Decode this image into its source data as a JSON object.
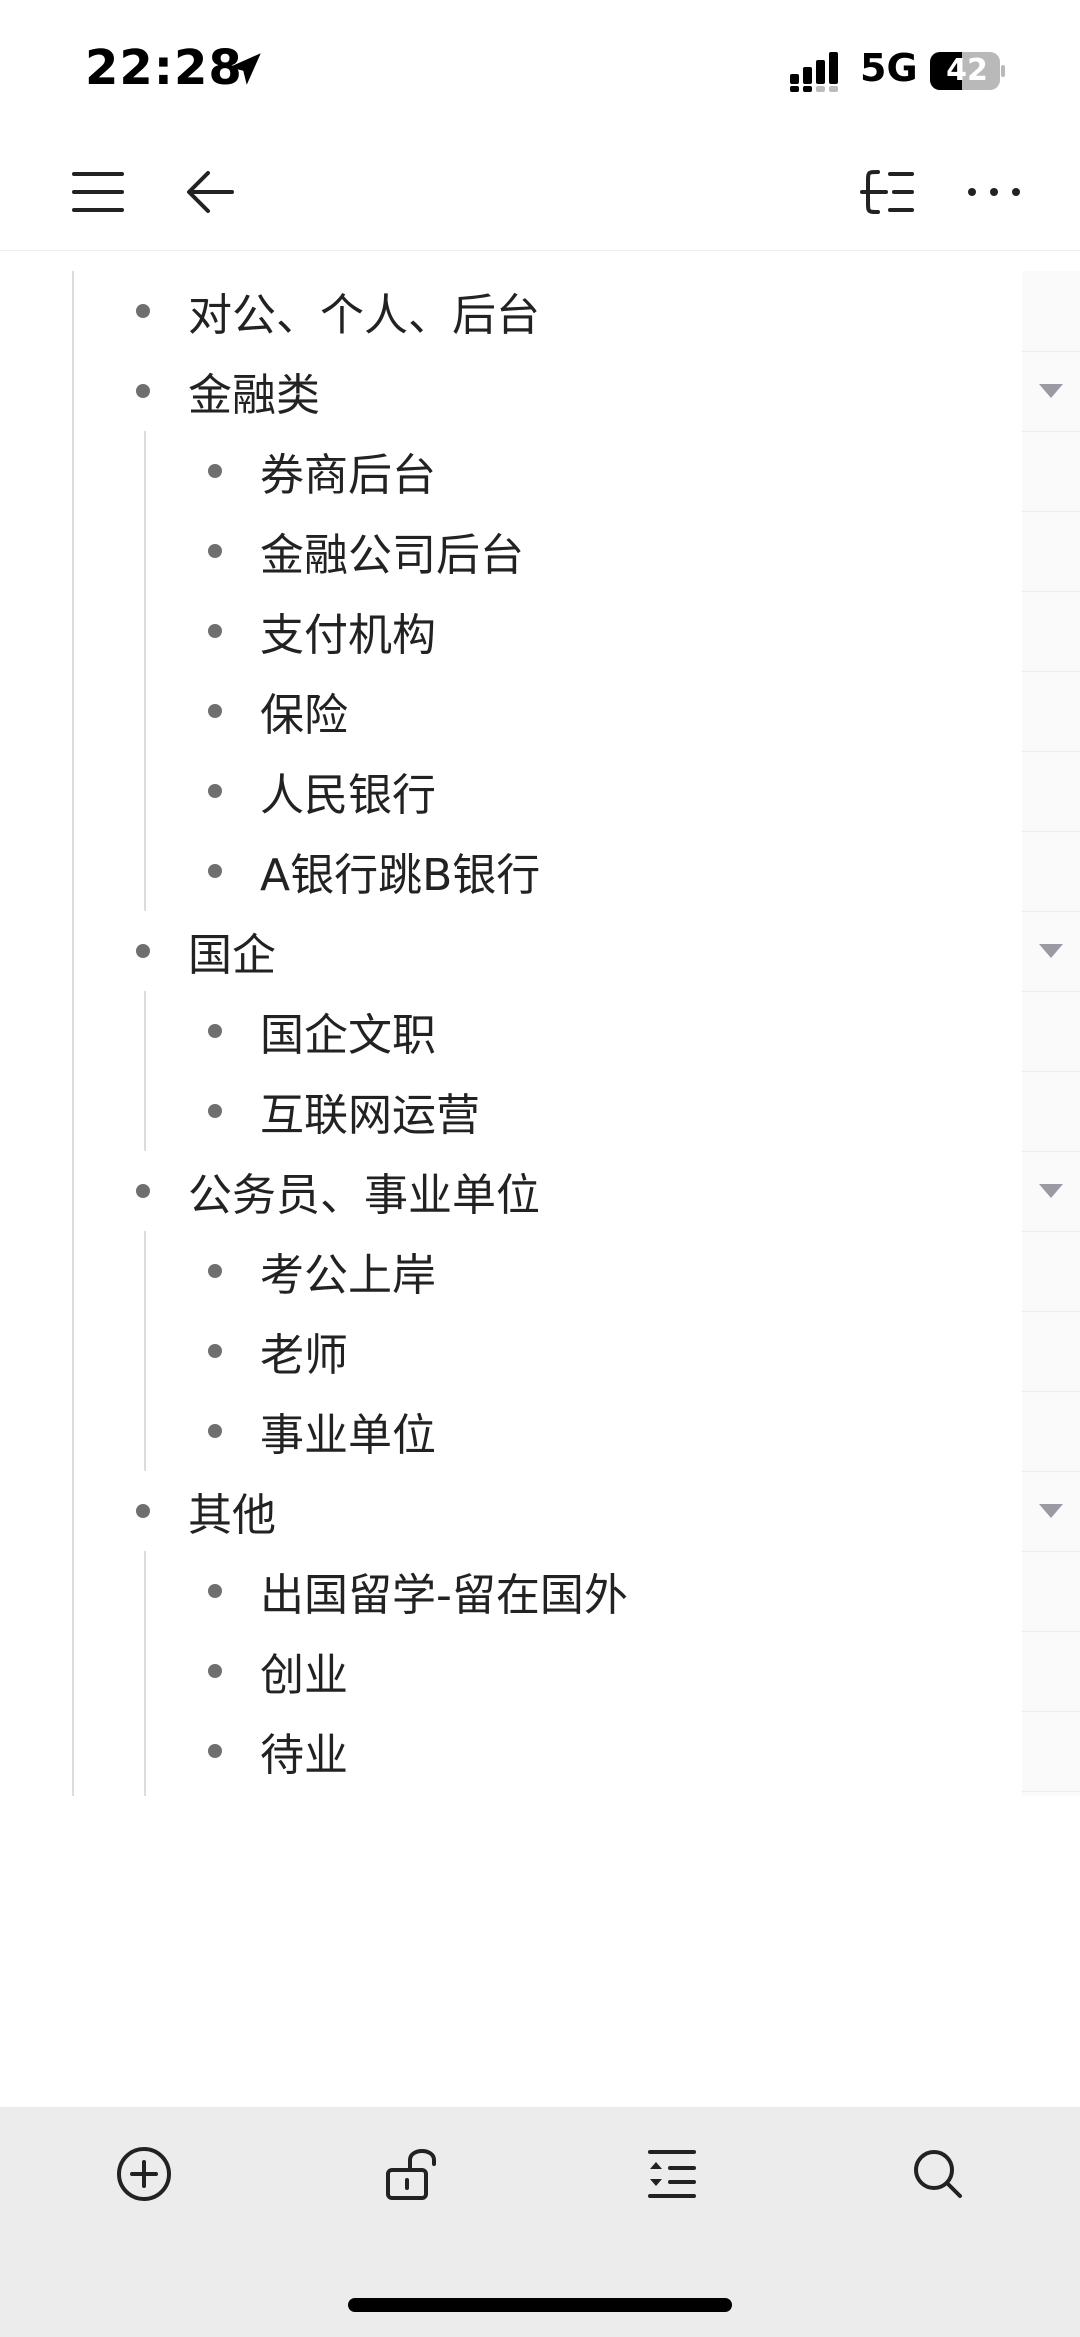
{
  "status_bar": {
    "time": "22:28",
    "network": "5G",
    "battery": "42",
    "icons": [
      "location-arrow-icon",
      "signal-icon",
      "battery-icon"
    ]
  },
  "toolbar": {
    "icons": [
      "menu-icon",
      "back-arrow-icon",
      "mindmap-icon",
      "more-icon"
    ]
  },
  "outline": {
    "items": [
      {
        "text": "对公、个人、后台",
        "level": 0
      },
      {
        "text": "金融类",
        "level": 0,
        "collapsible": true
      },
      {
        "text": "券商后台",
        "level": 1
      },
      {
        "text": "金融公司后台",
        "level": 1
      },
      {
        "text": "支付机构",
        "level": 1
      },
      {
        "text": "保险",
        "level": 1
      },
      {
        "text": "人民银行",
        "level": 1
      },
      {
        "text": "A银行跳B银行",
        "level": 1
      },
      {
        "text": "国企",
        "level": 0,
        "collapsible": true
      },
      {
        "text": "国企文职",
        "level": 1
      },
      {
        "text": "互联网运营",
        "level": 1
      },
      {
        "text": "公务员、事业单位",
        "level": 0,
        "collapsible": true
      },
      {
        "text": "考公上岸",
        "level": 1
      },
      {
        "text": "老师",
        "level": 1
      },
      {
        "text": "事业单位",
        "level": 1
      },
      {
        "text": "其他",
        "level": 0,
        "collapsible": true
      },
      {
        "text": "出国留学-留在国外",
        "level": 1
      },
      {
        "text": "创业",
        "level": 1
      },
      {
        "text": "待业",
        "level": 1
      }
    ]
  },
  "bottom_bar": {
    "icons": [
      "add-icon",
      "unlock-icon",
      "indent-icon",
      "search-icon"
    ]
  },
  "colors": {
    "background": "#ffffff",
    "bottom_bar": "#ececec",
    "bullet": "#6f6f6f",
    "text": "#222222"
  }
}
